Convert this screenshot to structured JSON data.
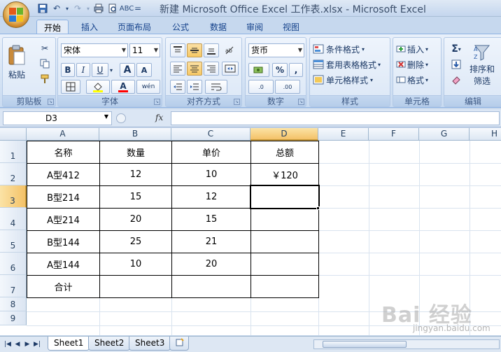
{
  "window": {
    "title": "新建 Microsoft Office Excel 工作表.xlsx - Microsoft Excel",
    "qat_customize": "="
  },
  "ribbon": {
    "tabs": [
      "开始",
      "插入",
      "页面布局",
      "公式",
      "数据",
      "审阅",
      "视图"
    ],
    "active_tab": "开始",
    "clipboard": {
      "label": "剪贴板",
      "paste": "粘贴"
    },
    "font": {
      "label": "字体",
      "name": "宋体",
      "size": "11",
      "bold": "B",
      "italic": "I",
      "underline": "U",
      "grow": "A",
      "shrink": "A",
      "color_letter": "A",
      "phonetic": "wén"
    },
    "alignment": {
      "label": "对齐方式"
    },
    "number": {
      "label": "数字",
      "format": "货币",
      "percent": "%",
      "comma": ",",
      "inc_decimal": ".0",
      "dec_decimal": ".00"
    },
    "styles": {
      "label": "样式",
      "conditional": "条件格式",
      "table_format": "套用表格格式",
      "cell_style": "单元格样式"
    },
    "cells": {
      "label": "单元格",
      "insert": "插入",
      "delete": "删除",
      "format": "格式"
    },
    "editing": {
      "label": "编辑",
      "sum": "Σ",
      "sort_filter_1": "排序和",
      "sort_filter_2": "筛选"
    }
  },
  "formula_bar": {
    "name_box": "D3",
    "fx": "fx",
    "formula": ""
  },
  "grid": {
    "columns": [
      "A",
      "B",
      "C",
      "D",
      "E",
      "F",
      "G",
      "H"
    ],
    "rows": [
      "1",
      "2",
      "3",
      "4",
      "5",
      "6",
      "7",
      "8",
      "9"
    ],
    "selected_cell": "D3",
    "cells": {
      "A1": "名称",
      "B1": "数量",
      "C1": "单价",
      "D1": "总额",
      "A2": "A型412",
      "B2": "12",
      "C2": "10",
      "D2": "￥120",
      "A3": "B型214",
      "B3": "15",
      "C3": "12",
      "D3": "",
      "A4": "A型214",
      "B4": "20",
      "C4": "15",
      "A5": "B型144",
      "B5": "25",
      "C5": "21",
      "A6": "A型144",
      "B6": "10",
      "C6": "20",
      "A7": "合计"
    }
  },
  "sheets": {
    "tabs": [
      "Sheet1",
      "Sheet2",
      "Sheet3"
    ],
    "active": "Sheet1"
  },
  "watermark": {
    "brand": "Bai 经验",
    "sub": "jingyan.baidu.com"
  }
}
